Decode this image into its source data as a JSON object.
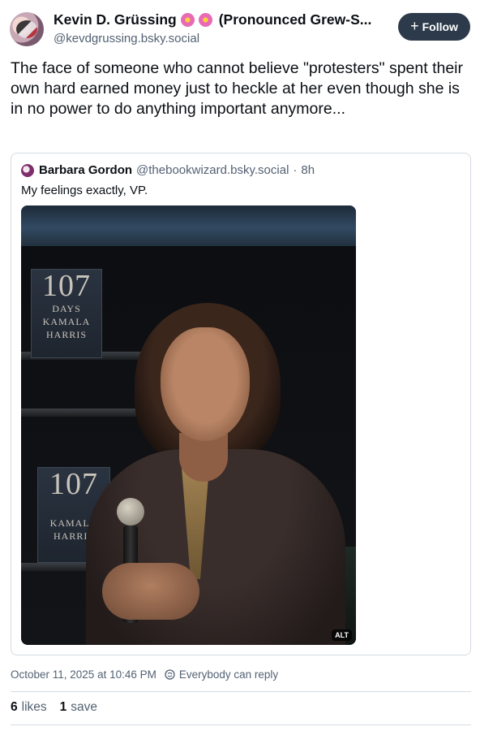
{
  "author": {
    "display_name": "Kevin D. Grüssing",
    "pronunciation": "(Pronounced Grew-S...",
    "handle": "@kevdgrussing.bsky.social",
    "follow_label": "Follow",
    "follow_icon": "+"
  },
  "post": {
    "text": "The face of someone who cannot believe \"protesters\" spent their own hard earned money just to heckle at her even though she is in no power to do anything important anymore...",
    "timestamp": "October 11, 2025 at 10:46 PM",
    "reply_setting": "Everybody can reply"
  },
  "quoted_post": {
    "display_name": "Barbara Gordon",
    "handle": "@thebookwizard.bsky.social",
    "separator": "·",
    "age": "8h",
    "text": "My feelings exactly, VP.",
    "image_alt_badge": "ALT",
    "image_text": {
      "book1_number": "107",
      "book1_days": "DAYS",
      "book1_first": "KAMALA",
      "book1_last": "HARRIS",
      "book2_number": "107",
      "book2_first": "KAMALA",
      "book2_last": "HARRIS"
    }
  },
  "stats": {
    "likes_count": "6",
    "likes_label": "likes",
    "saves_count": "1",
    "saves_label": "save"
  },
  "colors": {
    "follow_button_bg": "#2c3a4b",
    "secondary_text": "#536173",
    "border": "#d4dbe2"
  }
}
